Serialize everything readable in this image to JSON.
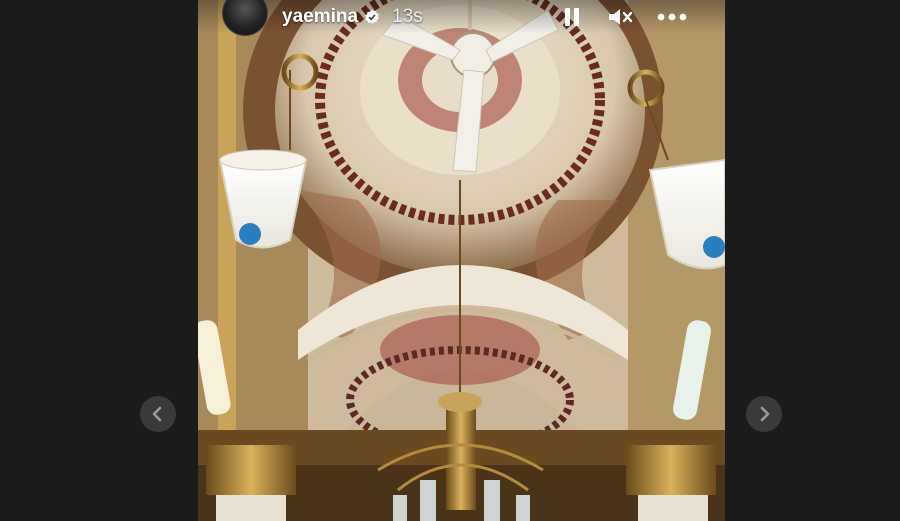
{
  "story": {
    "username": "yaemina",
    "verified": true,
    "elapsed": "13s"
  },
  "controls": {
    "pause_icon": "pause-icon",
    "mute_icon": "speaker-muted-icon",
    "more_icon": "more-options-icon"
  },
  "nav": {
    "prev_icon": "chevron-left-icon",
    "next_icon": "chevron-right-icon"
  },
  "colors": {
    "page_bg": "#1b1b1b",
    "nav_button_bg": "#3a3a3a",
    "text": "#ffffff"
  }
}
